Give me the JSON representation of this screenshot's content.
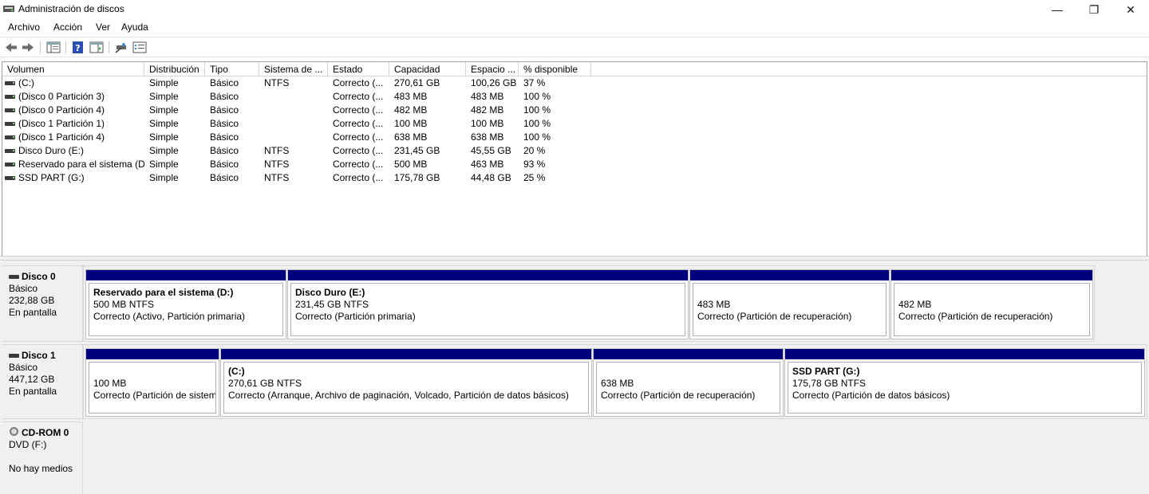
{
  "window": {
    "title": "Administración de discos",
    "controls": {
      "minimize": "—",
      "maximize": "❐",
      "close": "✕"
    }
  },
  "menu": [
    "Archivo",
    "Acción",
    "Ver",
    "Ayuda"
  ],
  "toolbar": {
    "buttons": [
      "back-icon",
      "forward-icon",
      "console-tree-icon",
      "help-icon",
      "properties-pane-icon",
      "connect-icon",
      "details-icon"
    ]
  },
  "list": {
    "columns": [
      "Volumen",
      "Distribución",
      "Tipo",
      "Sistema de ...",
      "Estado",
      "Capacidad",
      "Espacio ...",
      "% disponible"
    ],
    "rows": [
      {
        "volumen": " (C:)",
        "distribucion": "Simple",
        "tipo": "Básico",
        "sistema": "NTFS",
        "estado": "Correcto (...",
        "capacidad": "270,61 GB",
        "espacio": "100,26 GB",
        "porcentaje": "37 %"
      },
      {
        "volumen": "(Disco 0 Partición 3)",
        "distribucion": "Simple",
        "tipo": "Básico",
        "sistema": "",
        "estado": "Correcto (...",
        "capacidad": "483 MB",
        "espacio": "483 MB",
        "porcentaje": "100 %"
      },
      {
        "volumen": "(Disco 0 Partición 4)",
        "distribucion": "Simple",
        "tipo": "Básico",
        "sistema": "",
        "estado": "Correcto (...",
        "capacidad": "482 MB",
        "espacio": "482 MB",
        "porcentaje": "100 %"
      },
      {
        "volumen": "(Disco 1 Partición 1)",
        "distribucion": "Simple",
        "tipo": "Básico",
        "sistema": "",
        "estado": "Correcto (...",
        "capacidad": "100 MB",
        "espacio": "100 MB",
        "porcentaje": "100 %"
      },
      {
        "volumen": "(Disco 1 Partición 4)",
        "distribucion": "Simple",
        "tipo": "Básico",
        "sistema": "",
        "estado": "Correcto (...",
        "capacidad": "638 MB",
        "espacio": "638 MB",
        "porcentaje": "100 %"
      },
      {
        "volumen": "Disco Duro (E:)",
        "distribucion": "Simple",
        "tipo": "Básico",
        "sistema": "NTFS",
        "estado": "Correcto (...",
        "capacidad": "231,45 GB",
        "espacio": "45,55 GB",
        "porcentaje": "20 %"
      },
      {
        "volumen": "Reservado para el sistema (D:)",
        "distribucion": "Simple",
        "tipo": "Básico",
        "sistema": "NTFS",
        "estado": "Correcto (...",
        "capacidad": "500 MB",
        "espacio": "463 MB",
        "porcentaje": "93 %"
      },
      {
        "volumen": "SSD PART (G:)",
        "distribucion": "Simple",
        "tipo": "Básico",
        "sistema": "NTFS",
        "estado": "Correcto (...",
        "capacidad": "175,78 GB",
        "espacio": "44,48 GB",
        "porcentaje": "25 %"
      }
    ]
  },
  "disks": [
    {
      "name": "Disco 0",
      "type": "Básico",
      "size": "232,88 GB",
      "status": "En pantalla",
      "partitions": [
        {
          "title": "Reservado para el sistema  (D:)",
          "size": "500 MB NTFS",
          "status": "Correcto (Activo, Partición primaria)"
        },
        {
          "title": "Disco Duro  (E:)",
          "size": "231,45 GB NTFS",
          "status": "Correcto (Partición primaria)"
        },
        {
          "title": "",
          "size": "483 MB",
          "status": "Correcto (Partición de recuperación)"
        },
        {
          "title": "",
          "size": "482 MB",
          "status": "Correcto (Partición de recuperación)"
        }
      ]
    },
    {
      "name": "Disco 1",
      "type": "Básico",
      "size": "447,12 GB",
      "status": "En pantalla",
      "partitions": [
        {
          "title": "",
          "size": "100 MB",
          "status": "Correcto (Partición de sistema"
        },
        {
          "title": " (C:)",
          "size": "270,61 GB NTFS",
          "status": "Correcto (Arranque, Archivo de paginación, Volcado, Partición de datos básicos)"
        },
        {
          "title": "",
          "size": "638 MB",
          "status": "Correcto (Partición de recuperación)"
        },
        {
          "title": "SSD PART  (G:)",
          "size": "175,78 GB NTFS",
          "status": "Correcto (Partición de datos básicos)"
        }
      ]
    }
  ],
  "cdrom": {
    "name": "CD-ROM 0",
    "drive": "DVD (F:)",
    "status": "No hay medios"
  },
  "colors": {
    "partition_bar": "#00007f",
    "background": "#f0f0f0"
  }
}
